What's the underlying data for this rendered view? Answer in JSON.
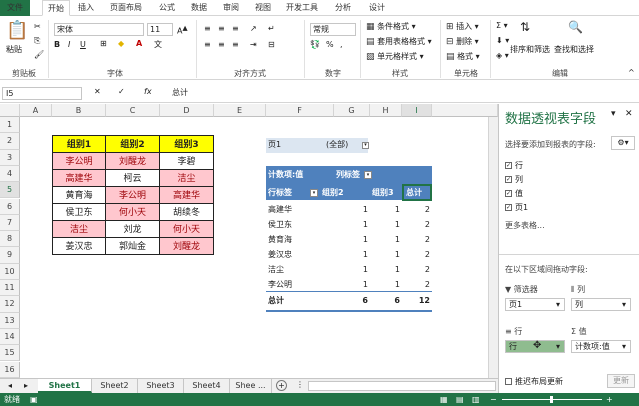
{
  "ribbon_tabs": [
    "文件",
    "开始",
    "插入",
    "页面布局",
    "公式",
    "数据",
    "审阅",
    "视图",
    "开发工具",
    "分析",
    "设计"
  ],
  "ribbon": {
    "paste": "粘贴",
    "clipboard": "剪贴板",
    "font_name": "宋体",
    "font_size": "11",
    "font_group": "字体",
    "align_group": "对齐方式",
    "number_format": "常规",
    "number_group": "数字",
    "cond_format": "条件格式",
    "table_format": "套用表格格式",
    "cell_style": "单元格样式",
    "style_group": "样式",
    "insert": "插入",
    "delete": "删除",
    "format": "格式",
    "cells_group": "单元格",
    "sort_filter": "排序和筛选",
    "find_select": "查找和选择",
    "edit_group": "编辑",
    "bold": "B",
    "italic": "I",
    "underline": "U"
  },
  "formula_bar": {
    "name_box": "I5",
    "fx": "fx",
    "content": "总计"
  },
  "columns": [
    "A",
    "B",
    "C",
    "D",
    "E",
    "F",
    "G",
    "H",
    "I"
  ],
  "rows": [
    "1",
    "2",
    "3",
    "4",
    "5",
    "6",
    "7",
    "8",
    "9",
    "10",
    "11",
    "12",
    "13",
    "14",
    "15",
    "16"
  ],
  "source_table": {
    "headers": [
      "组别1",
      "组别2",
      "组别3"
    ],
    "rows": [
      [
        "李公明",
        "刘醒龙",
        "李碧"
      ],
      [
        "高建华",
        "柯云",
        "洁尘"
      ],
      [
        "黄育海",
        "李公明",
        "高建华"
      ],
      [
        "侯卫东",
        "何小天",
        "胡续冬"
      ],
      [
        "洁尘",
        "刘龙",
        "何小天"
      ],
      [
        "姜汉忠",
        "郭灿金",
        "刘醒龙"
      ]
    ]
  },
  "pivot": {
    "page_field": "页1",
    "page_value": "(全部)",
    "count_label": "计数项:值",
    "col_label": "列标签",
    "row_label": "行标签",
    "col_headers": [
      "组别2",
      "组别3",
      "总计"
    ],
    "rows": [
      {
        "name": "高建华",
        "v": [
          "1",
          "1",
          "2"
        ]
      },
      {
        "name": "侯卫东",
        "v": [
          "1",
          "1",
          "2"
        ]
      },
      {
        "name": "黄育海",
        "v": [
          "1",
          "1",
          "2"
        ]
      },
      {
        "name": "姜汉忠",
        "v": [
          "1",
          "1",
          "2"
        ]
      },
      {
        "name": "洁尘",
        "v": [
          "1",
          "1",
          "2"
        ]
      },
      {
        "name": "李公明",
        "v": [
          "1",
          "1",
          "2"
        ]
      }
    ],
    "total_label": "总计",
    "totals": [
      "6",
      "6",
      "12"
    ]
  },
  "sheets": [
    "Sheet1",
    "Sheet2",
    "Sheet3",
    "Sheet4",
    "Shee ..."
  ],
  "status": "就绪",
  "pane": {
    "title": "数据透视表字段",
    "subtitle": "选择要添加到报表的字段:",
    "fields": [
      "行",
      "列",
      "值",
      "页1"
    ],
    "more": "更多表格...",
    "drag_hint": "在以下区域间拖动字段:",
    "filter_area": "筛选器",
    "col_area": "列",
    "row_area": "行",
    "val_area": "值",
    "filter_item": "页1",
    "col_item": "列",
    "row_item": "行",
    "val_item": "计数项:值",
    "defer": "推迟布局更新",
    "update": "更新"
  },
  "colors": {
    "accent": "#217346",
    "yellow": "#ffff00",
    "pink": "#ffc7ce",
    "pivot_header": "#4f81bd"
  }
}
